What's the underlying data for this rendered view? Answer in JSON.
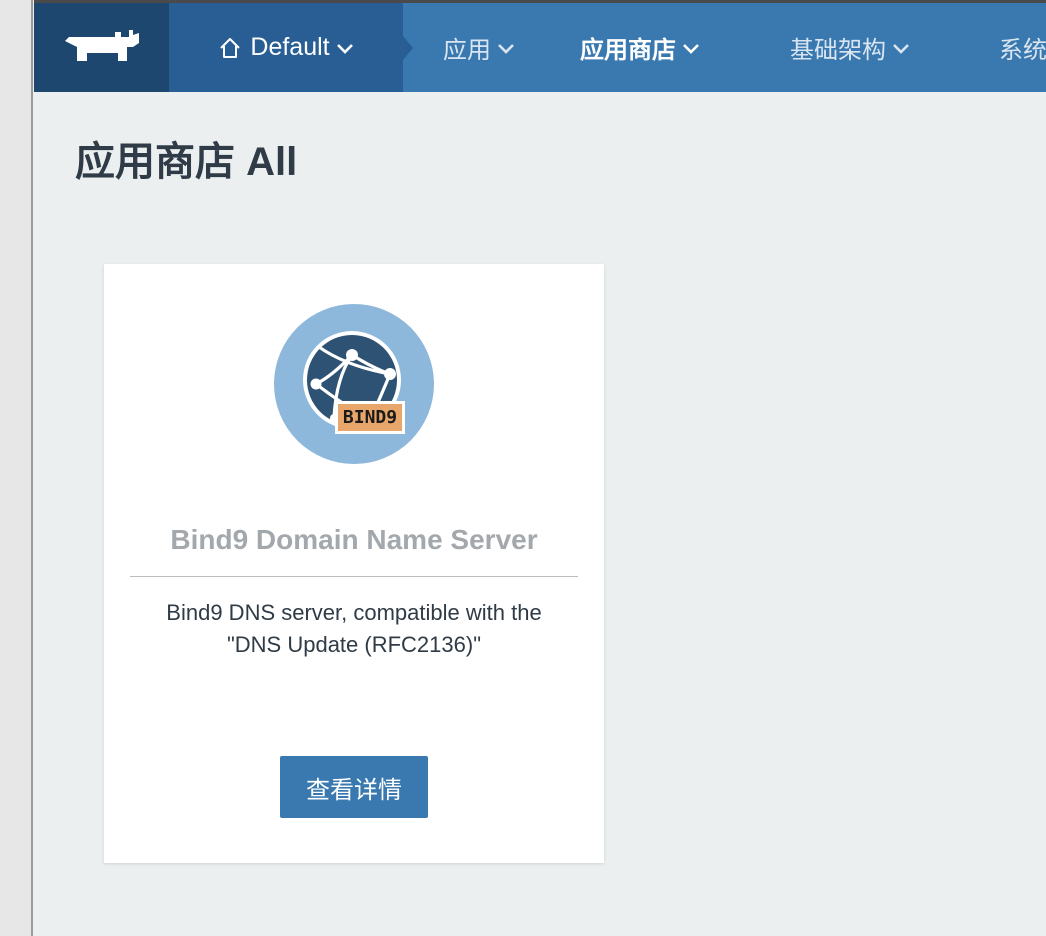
{
  "header": {
    "environment": {
      "label": "Default",
      "icon": "home-icon"
    },
    "nav": [
      {
        "label": "应用",
        "active": false
      },
      {
        "label": "应用商店",
        "active": true
      },
      {
        "label": "基础架构",
        "active": false
      },
      {
        "label": "系统"
      }
    ]
  },
  "page": {
    "title": "应用商店 All"
  },
  "card": {
    "logo_text": "BIND9",
    "title": "Bind9 Domain Name Server",
    "description": "Bind9 DNS server, compatible with the \"DNS Update (RFC2136)\"",
    "button_label": "查看详情"
  },
  "colors": {
    "brand": "#3a79b0",
    "brand_dark": "#1e4770",
    "env_bg": "#285e93",
    "page_bg": "#eceff0",
    "logo_circle": "#8db8dc",
    "globe": "#2d5273",
    "badge": "#e8a66a"
  }
}
